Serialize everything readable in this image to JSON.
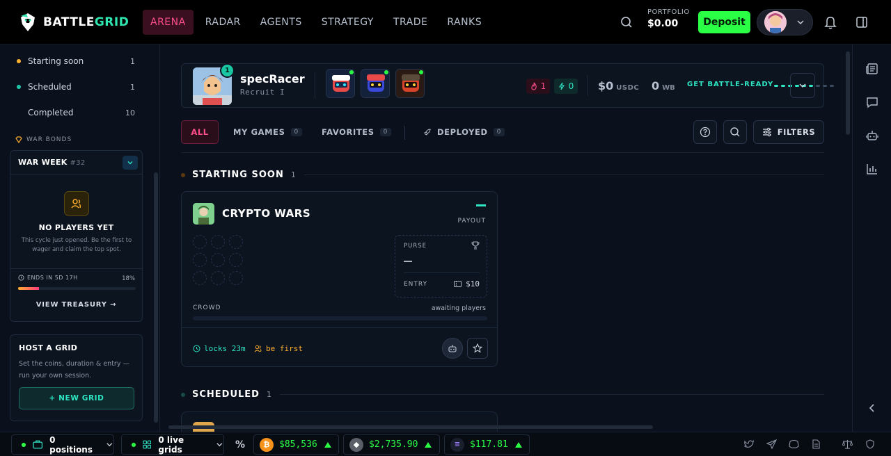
{
  "brand": {
    "name_part1": "BATTLE",
    "name_part2": "GRID"
  },
  "nav": {
    "links": [
      "ARENA",
      "RADAR",
      "AGENTS",
      "STRATEGY",
      "TRADE",
      "RANKS"
    ],
    "active": "ARENA",
    "portfolio_label": "PORTFOLIO",
    "portfolio_value": "$0.00",
    "deposit_label": "Deposit"
  },
  "sidebar": {
    "statuses": [
      {
        "label": "Starting soon",
        "count": "1",
        "color": "#ffb02e"
      },
      {
        "label": "Scheduled",
        "count": "1",
        "color": "#1fc9a8"
      },
      {
        "label": "Completed",
        "count": "10",
        "color": ""
      }
    ],
    "war_bonds_label": "WAR BONDS",
    "war_week": {
      "title": "WAR WEEK",
      "number": "#32",
      "empty_title": "NO PLAYERS YET",
      "empty_sub": "This cycle just opened. Be the first to wager and claim the top spot.",
      "ends_label": "ENDS IN 5D 17H",
      "progress_label": "18%",
      "progress": 0.18,
      "view_label": "VIEW TREASURY"
    },
    "host": {
      "title": "HOST A GRID",
      "subtitle": "Set the coins, duration & entry — run your own session.",
      "button": "+ NEW GRID"
    }
  },
  "player": {
    "name": "specRacer",
    "rank_title": "Recruit I",
    "level": "1",
    "streak": "1",
    "energy": "0",
    "usdc_value": "$0",
    "usdc_unit": "USDC",
    "wb_value": "0",
    "wb_unit": "WB",
    "cta": "GET BATTLE-READY"
  },
  "tabs": [
    {
      "label": "ALL",
      "count": ""
    },
    {
      "label": "MY GAMES",
      "count": "0"
    },
    {
      "label": "FAVORITES",
      "count": "0"
    },
    {
      "label": "DEPLOYED",
      "count": "0"
    }
  ],
  "filters_label": "FILTERS",
  "sections": {
    "starting_soon": {
      "title": "STARTING SOON",
      "count": "1"
    },
    "scheduled": {
      "title": "SCHEDULED",
      "count": "1"
    }
  },
  "game": {
    "title": "CRYPTO WARS",
    "payout_label": "PAYOUT",
    "purse_label": "PURSE",
    "entry_label": "ENTRY",
    "entry_value": "$10",
    "crowd_label": "CROWD",
    "crowd_state": "awaiting players",
    "locks": "locks 23m",
    "be_first": "be first"
  },
  "bottombar": {
    "positions": "0 positions",
    "live_grids": "0 live grids",
    "percent_symbol": "%",
    "coins": [
      {
        "symbol": "BTC",
        "price": "$85,536",
        "color": "#f7931a"
      },
      {
        "symbol": "ETH",
        "price": "$2,735.90",
        "color": "#8a8f98"
      },
      {
        "symbol": "SOL",
        "price": "$117.81",
        "color": "#1a1f2e"
      }
    ]
  }
}
